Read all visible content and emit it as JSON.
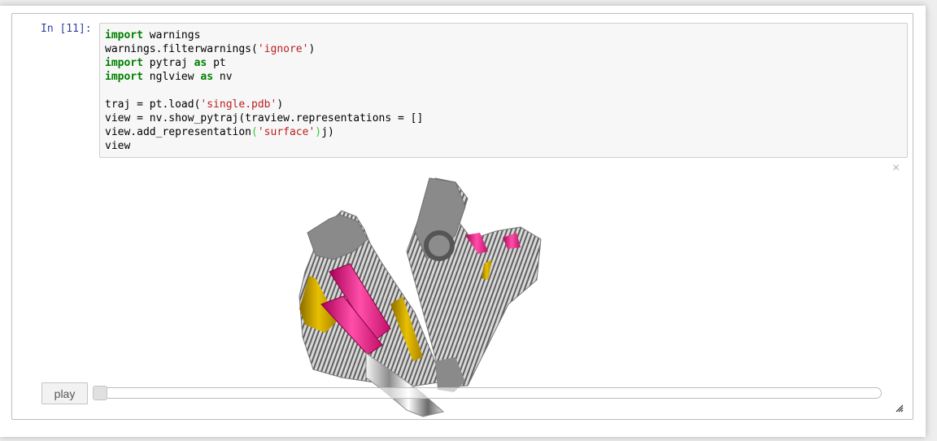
{
  "cell": {
    "prompt": "In [11]:",
    "code_lines": [
      [
        {
          "t": "import",
          "c": "kw"
        },
        {
          "t": " warnings",
          "c": ""
        }
      ],
      [
        {
          "t": "warnings.filterwarnings(",
          "c": ""
        },
        {
          "t": "'ignore'",
          "c": "str"
        },
        {
          "t": ")",
          "c": ""
        }
      ],
      [
        {
          "t": "import",
          "c": "kw"
        },
        {
          "t": " pytraj ",
          "c": ""
        },
        {
          "t": "as",
          "c": "kw"
        },
        {
          "t": " pt",
          "c": ""
        }
      ],
      [
        {
          "t": "import",
          "c": "kw"
        },
        {
          "t": " nglview ",
          "c": ""
        },
        {
          "t": "as",
          "c": "kw"
        },
        {
          "t": " nv",
          "c": ""
        }
      ],
      [
        {
          "t": "",
          "c": ""
        }
      ],
      [
        {
          "t": "traj = pt.load(",
          "c": ""
        },
        {
          "t": "'single.pdb'",
          "c": "str"
        },
        {
          "t": ")",
          "c": ""
        }
      ],
      [
        {
          "t": "view = nv.show_pytraj(traview.representations = []",
          "c": ""
        }
      ],
      [
        {
          "t": "view.add_representation",
          "c": ""
        },
        {
          "t": "(",
          "c": "paren-hl"
        },
        {
          "t": "'surface'",
          "c": "str"
        },
        {
          "t": ")",
          "c": "paren-hl"
        },
        {
          "t": "j)",
          "c": ""
        }
      ],
      [
        {
          "t": "view",
          "c": ""
        }
      ]
    ]
  },
  "output": {
    "close_icon": "×",
    "play_label": "play",
    "frame_slider_value": 0,
    "colors": {
      "surface": "#8a8a8a",
      "magenta": "#e0177c",
      "gold": "#c9a000"
    }
  }
}
